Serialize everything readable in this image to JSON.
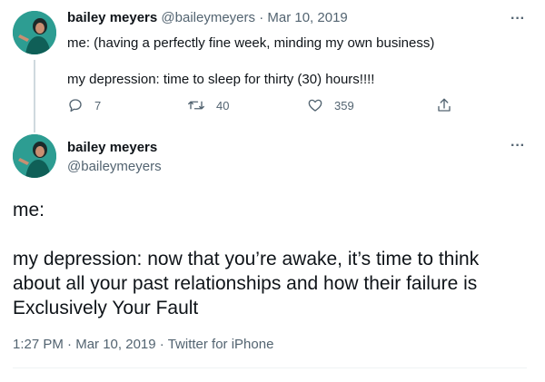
{
  "parent": {
    "name": "bailey meyers",
    "handle": "@baileymeyers",
    "separator": "·",
    "date": "Mar 10, 2019",
    "text_lines": [
      "me: (having a perfectly fine week, minding my own business)",
      "my depression: time to sleep for thirty (30) hours!!!!"
    ],
    "more_label": "···",
    "replies": "7",
    "retweets": "40",
    "likes": "359"
  },
  "main": {
    "name": "bailey meyers",
    "handle": "@baileymeyers",
    "more_label": "···",
    "text_lines": [
      "me:",
      "my depression: now that you’re awake, it’s time to think about all your past relationships and how their failure is Exclusively Your Fault"
    ],
    "time": "1:27 PM",
    "separator": "·",
    "date": "Mar 10, 2019",
    "source": "Twitter for iPhone"
  },
  "icons": {
    "reply": "reply-icon",
    "retweet": "retweet-icon",
    "like": "heart-icon",
    "share": "share-icon",
    "more": "more-icon"
  },
  "colors": {
    "text": "#0f1419",
    "muted": "#536471",
    "thread_line": "#cfd9de",
    "avatar_bg": "#2a9a8f"
  }
}
